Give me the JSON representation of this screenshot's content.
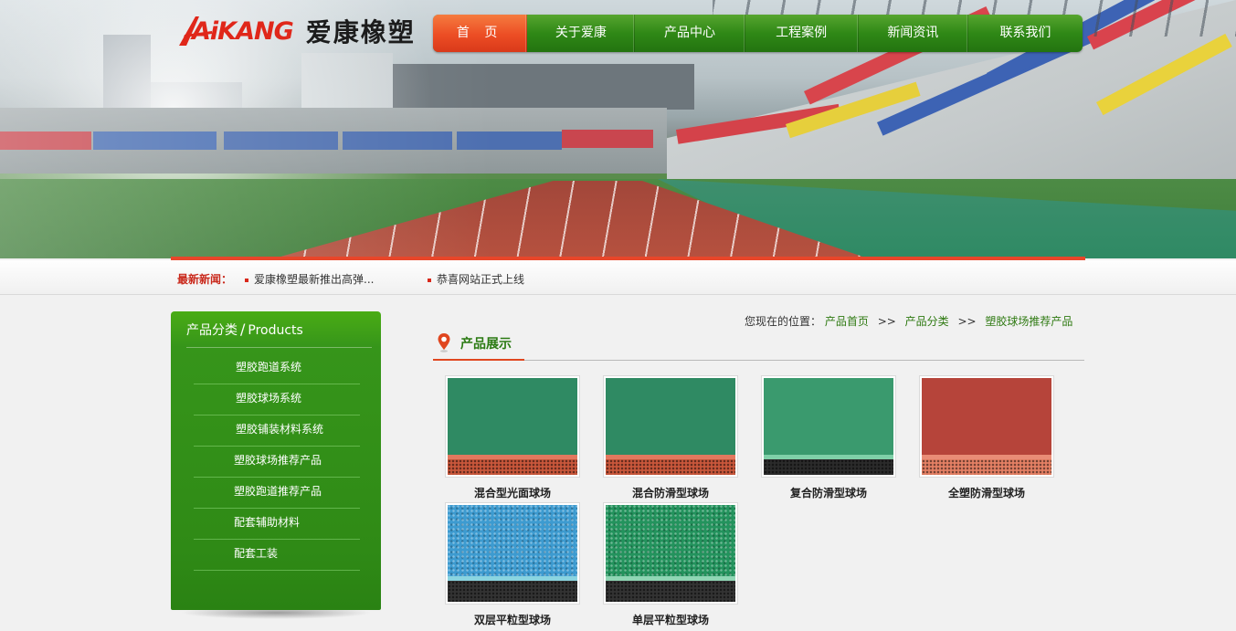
{
  "brand": {
    "logo_mark": "AiKANG",
    "name": "爱康橡塑"
  },
  "nav": {
    "items": [
      {
        "label": "首 页",
        "active": true
      },
      {
        "label": "关于爱康",
        "active": false
      },
      {
        "label": "产品中心",
        "active": false
      },
      {
        "label": "工程案例",
        "active": false
      },
      {
        "label": "新闻资讯",
        "active": false
      },
      {
        "label": "联系我们",
        "active": false
      }
    ]
  },
  "news": {
    "label": "最新新闻：",
    "items": [
      "爱康橡塑最新推出高弹...",
      "恭喜网站正式上线"
    ]
  },
  "sidebar": {
    "title_cn": "产品分类",
    "title_sep": "/",
    "title_en": "Products",
    "items": [
      "塑胶跑道系统",
      "塑胶球场系统",
      "塑胶铺装材料系统",
      "塑胶球场推荐产品",
      "塑胶跑道推荐产品",
      "配套辅助材料",
      "配套工装"
    ]
  },
  "breadcrumb": {
    "prefix": "您现在的位置：",
    "links": [
      "产品首页",
      "产品分类",
      "塑胶球场推荐产品"
    ],
    "separator": ">>"
  },
  "section": {
    "title": "产品展示"
  },
  "products": [
    {
      "name": "混合型光面球场",
      "top_color": "#2f8a63",
      "strip_color": "#e2785e",
      "bottom_color": "#c9573b"
    },
    {
      "name": "混合防滑型球场",
      "top_color": "#2f8a63",
      "strip_color": "#e2785e",
      "bottom_color": "#c9573b"
    },
    {
      "name": "复合防滑型球场",
      "top_color": "#3a9a6e",
      "strip_color": "#7fd0a8",
      "bottom_color": "#2b2b2b"
    },
    {
      "name": "全塑防滑型球场",
      "top_color": "#b6443a",
      "strip_color": "#e98c76",
      "bottom_color": "#e48064"
    },
    {
      "name": "双层平粒型球场",
      "top_color": "#3d9bd0",
      "strip_color": "#8ad4e0",
      "bottom_color": "#333333"
    },
    {
      "name": "单层平粒型球场",
      "top_color": "#23935d",
      "strip_color": "#8fd6b4",
      "bottom_color": "#333333"
    }
  ],
  "colors": {
    "nav_green": "#2f8816",
    "nav_active": "#ec4d24",
    "accent_red": "#e8462a",
    "sidebar_green": "#36951a",
    "link_green": "#2f7a12"
  }
}
